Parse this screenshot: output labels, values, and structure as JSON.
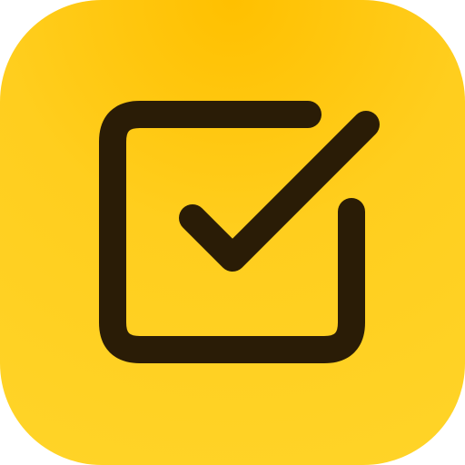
{
  "icon": {
    "name": "checkbox-checked-icon",
    "colors": {
      "background_top": "#ffc000",
      "background_bottom": "#ffd428",
      "glyph": "#2a1c06"
    }
  }
}
